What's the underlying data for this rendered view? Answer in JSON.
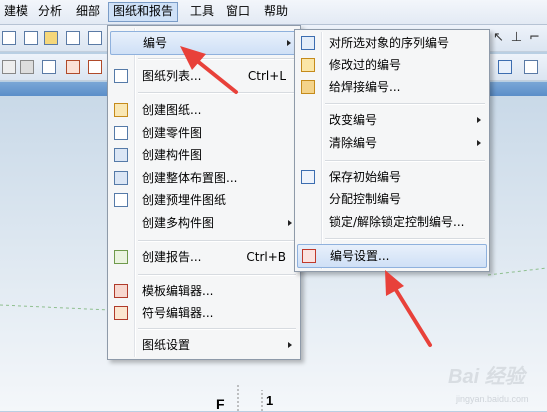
{
  "menubar": {
    "items": [
      "建模",
      "分析",
      "细部",
      "图纸和报告",
      "工具",
      "窗口",
      "帮助"
    ]
  },
  "drawings_menu": {
    "items": [
      {
        "label": "编号",
        "shortcut": "",
        "submenu": true
      },
      {
        "label": "图纸列表...",
        "shortcut": "Ctrl+L",
        "submenu": false
      },
      {
        "label": "创建图纸...",
        "shortcut": "",
        "submenu": false
      },
      {
        "label": "创建零件图",
        "shortcut": "",
        "submenu": false
      },
      {
        "label": "创建构件图",
        "shortcut": "",
        "submenu": false
      },
      {
        "label": "创建整体布置图...",
        "shortcut": "",
        "submenu": false
      },
      {
        "label": "创建预埋件图纸",
        "shortcut": "",
        "submenu": false
      },
      {
        "label": "创建多构件图",
        "shortcut": "",
        "submenu": true
      },
      {
        "label": "创建报告...",
        "shortcut": "Ctrl+B",
        "submenu": false
      },
      {
        "label": "模板编辑器...",
        "shortcut": "",
        "submenu": false
      },
      {
        "label": "符号编辑器...",
        "shortcut": "",
        "submenu": false
      },
      {
        "label": "图纸设置",
        "shortcut": "",
        "submenu": true
      }
    ]
  },
  "numbering_submenu": {
    "items": [
      {
        "label": "对所选对象的序列编号",
        "submenu": false
      },
      {
        "label": "修改过的编号",
        "submenu": false
      },
      {
        "label": "给焊接编号...",
        "submenu": false
      },
      {
        "label": "改变编号",
        "submenu": true
      },
      {
        "label": "清除编号",
        "submenu": true
      },
      {
        "label": "保存初始编号",
        "submenu": false
      },
      {
        "label": "分配控制编号",
        "submenu": false
      },
      {
        "label": "锁定/解除锁定控制编号...",
        "submenu": false
      },
      {
        "label": "编号设置...",
        "submenu": false
      }
    ]
  },
  "canvas": {
    "label_f": "F",
    "label_1": "1"
  },
  "watermark": {
    "brand": "Bai 经验",
    "url": "jingyan.baidu.com"
  },
  "colors": {
    "highlight": "#cfe0f6",
    "arrow": "#e8413a",
    "background": "#c9d9e8"
  }
}
